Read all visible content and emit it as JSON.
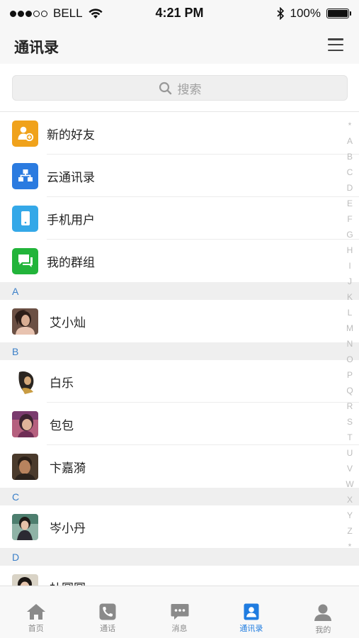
{
  "status_bar": {
    "carrier": "BELL",
    "time": "4:21 PM",
    "battery": "100%",
    "battery_level": 1.0,
    "signal_bars": 3,
    "signal_total": 5
  },
  "nav": {
    "title": "通讯录"
  },
  "search": {
    "placeholder": "搜索"
  },
  "functions": [
    {
      "label": "新的好友",
      "icon": "add-friend-icon",
      "color": "#f0a21b"
    },
    {
      "label": "云通讯录",
      "icon": "org-chart-icon",
      "color": "#2b7be0"
    },
    {
      "label": "手机用户",
      "icon": "phone-icon",
      "color": "#34a8e8"
    },
    {
      "label": "我的群组",
      "icon": "group-chat-icon",
      "color": "#22b43a"
    }
  ],
  "sections": [
    {
      "letter": "A",
      "contacts": [
        {
          "name": "艾小灿"
        }
      ]
    },
    {
      "letter": "B",
      "contacts": [
        {
          "name": "白乐"
        },
        {
          "name": "包包"
        },
        {
          "name": "卞嘉漪"
        }
      ]
    },
    {
      "letter": "C",
      "contacts": [
        {
          "name": "岑小丹"
        }
      ]
    },
    {
      "letter": "D",
      "contacts": [
        {
          "name": "杜圆圆"
        }
      ]
    }
  ],
  "index_letters": [
    "*",
    "A",
    "B",
    "C",
    "D",
    "E",
    "F",
    "G",
    "H",
    "I",
    "J",
    "K",
    "L",
    "M",
    "N",
    "O",
    "P",
    "Q",
    "R",
    "S",
    "T",
    "U",
    "V",
    "W",
    "X",
    "Y",
    "Z",
    "*"
  ],
  "tabs": [
    {
      "label": "首页",
      "icon": "home-icon",
      "active": false
    },
    {
      "label": "通话",
      "icon": "call-icon",
      "active": false
    },
    {
      "label": "消息",
      "icon": "message-icon",
      "active": false
    },
    {
      "label": "通讯录",
      "icon": "contacts-icon",
      "active": true
    },
    {
      "label": "我的",
      "icon": "profile-icon",
      "active": false
    }
  ],
  "colors": {
    "accent": "#1f7ce0",
    "section_letter": "#3a7fc8",
    "tab_inactive": "#8a8a8a"
  }
}
